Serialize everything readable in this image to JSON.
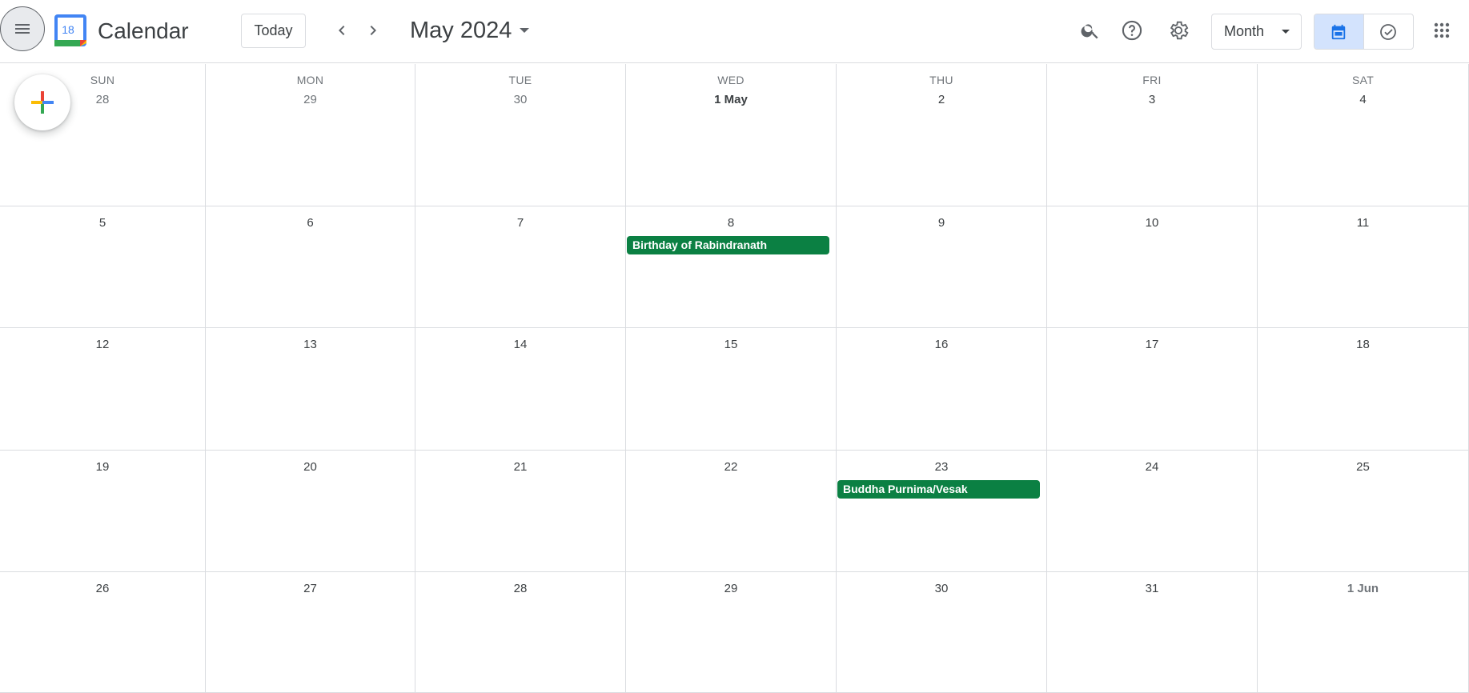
{
  "app": {
    "title": "Calendar",
    "logo_day": "18"
  },
  "toolbar": {
    "today_label": "Today",
    "current_period": "May 2024",
    "view_label": "Month"
  },
  "icons": {
    "menu": "hamburger-menu-icon",
    "prev": "chevron-left-icon",
    "next": "chevron-right-icon",
    "search": "search-icon",
    "help": "help-icon",
    "settings": "gear-icon",
    "calendar_view": "calendar-icon",
    "tasks_view": "tasks-check-icon",
    "apps": "apps-grid-icon",
    "create": "plus-icon"
  },
  "colors": {
    "event_green": "#0b8043",
    "toggle_active": "#d3e3fd",
    "accent_blue": "#1a73e8"
  },
  "weekdays": [
    "SUN",
    "MON",
    "TUE",
    "WED",
    "THU",
    "FRI",
    "SAT"
  ],
  "weeks": [
    [
      "28",
      "29",
      "30",
      "1 May",
      "2",
      "3",
      "4"
    ],
    [
      "5",
      "6",
      "7",
      "8",
      "9",
      "10",
      "11"
    ],
    [
      "12",
      "13",
      "14",
      "15",
      "16",
      "17",
      "18"
    ],
    [
      "19",
      "20",
      "21",
      "22",
      "23",
      "24",
      "25"
    ],
    [
      "26",
      "27",
      "28",
      "29",
      "30",
      "31",
      "1 Jun"
    ]
  ],
  "events": [
    {
      "title": "Birthday of Rabindranath",
      "week": 1,
      "day": 3
    },
    {
      "title": "Buddha Purnima/Vesak",
      "week": 3,
      "day": 4
    }
  ]
}
